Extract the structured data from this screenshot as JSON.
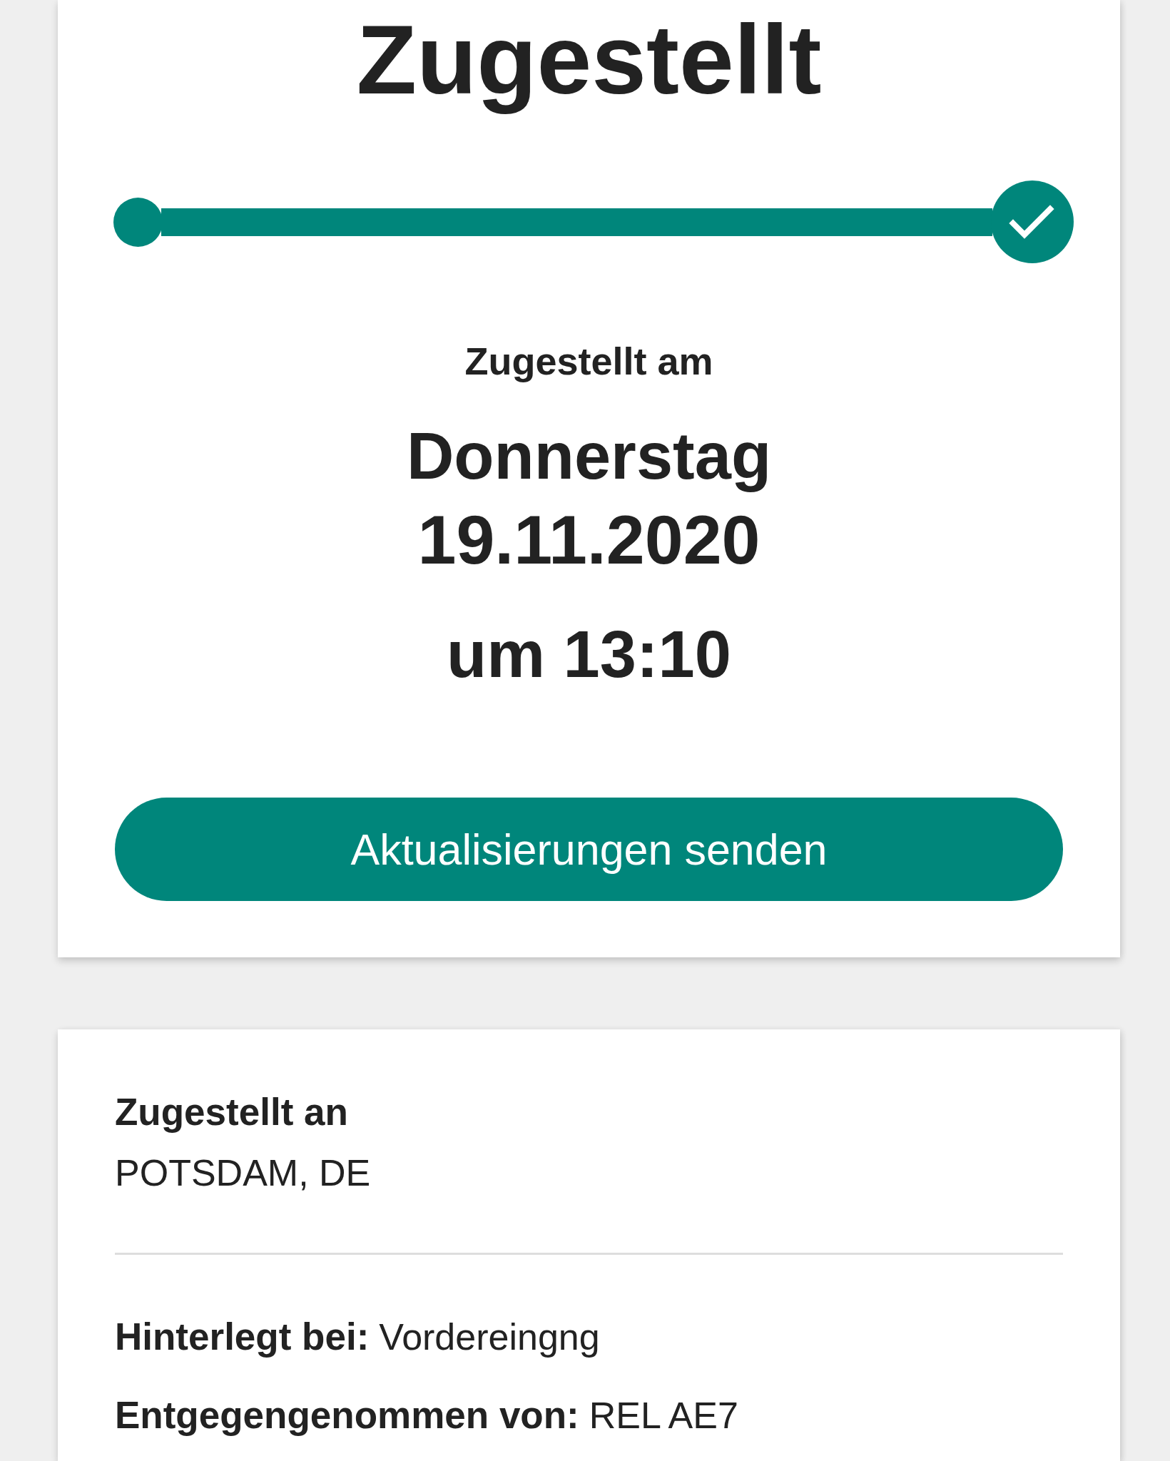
{
  "status_card": {
    "title": "Zugestellt",
    "progress": {
      "level": 1
    },
    "delivered_label": "Zugestellt am",
    "weekday": "Donnerstag",
    "date": "19.11.2020",
    "time": "um 13:10",
    "button": "Aktualisierungen senden"
  },
  "details_card": {
    "recipient_label": "Zugestellt an",
    "recipient_location": "POTSDAM, DE",
    "fields": [
      {
        "label": "Hinterlegt bei:",
        "value": "Vordereingng"
      },
      {
        "label": "Entgegengenommen von:",
        "value": "REL AE7"
      }
    ]
  }
}
